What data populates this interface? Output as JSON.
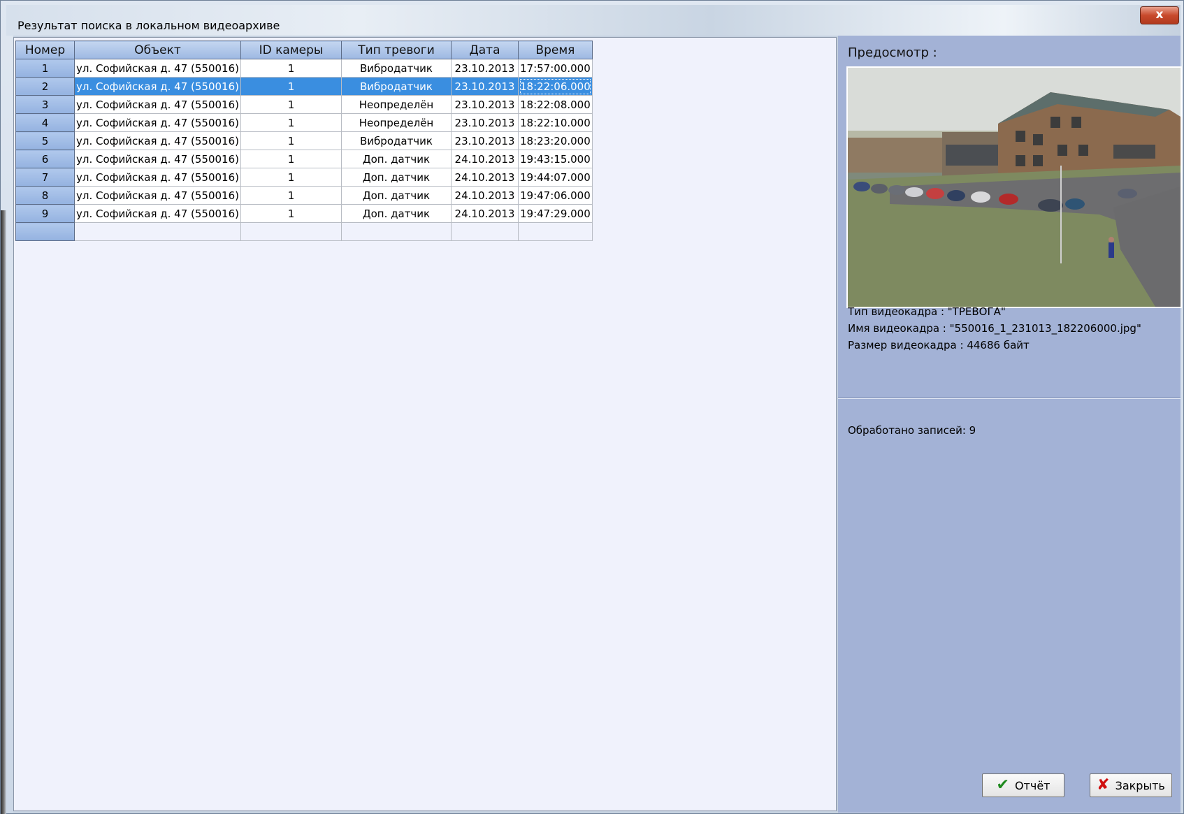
{
  "window": {
    "title": "Результат поиска в локальном видеоархиве",
    "close_label": "x"
  },
  "table": {
    "headers": [
      "Номер",
      "Объект",
      "ID камеры",
      "Тип тревоги",
      "Дата",
      "Время"
    ],
    "selected_index": 1,
    "rows": [
      {
        "num": "1",
        "object": "ул. Софийская д. 47 (550016)",
        "camera_id": "1",
        "alarm_type": "Вибродатчик",
        "date": "23.10.2013",
        "time": "17:57:00.000"
      },
      {
        "num": "2",
        "object": "ул. Софийская д. 47 (550016)",
        "camera_id": "1",
        "alarm_type": "Вибродатчик",
        "date": "23.10.2013",
        "time": "18:22:06.000"
      },
      {
        "num": "3",
        "object": "ул. Софийская д. 47 (550016)",
        "camera_id": "1",
        "alarm_type": "Неопределён",
        "date": "23.10.2013",
        "time": "18:22:08.000"
      },
      {
        "num": "4",
        "object": "ул. Софийская д. 47 (550016)",
        "camera_id": "1",
        "alarm_type": "Неопределён",
        "date": "23.10.2013",
        "time": "18:22:10.000"
      },
      {
        "num": "5",
        "object": "ул. Софийская д. 47 (550016)",
        "camera_id": "1",
        "alarm_type": "Вибродатчик",
        "date": "23.10.2013",
        "time": "18:23:20.000"
      },
      {
        "num": "6",
        "object": "ул. Софийская д. 47 (550016)",
        "camera_id": "1",
        "alarm_type": "Доп. датчик",
        "date": "24.10.2013",
        "time": "19:43:15.000"
      },
      {
        "num": "7",
        "object": "ул. Софийская д. 47 (550016)",
        "camera_id": "1",
        "alarm_type": "Доп. датчик",
        "date": "24.10.2013",
        "time": "19:44:07.000"
      },
      {
        "num": "8",
        "object": "ул. Софийская д. 47 (550016)",
        "camera_id": "1",
        "alarm_type": "Доп. датчик",
        "date": "24.10.2013",
        "time": "19:47:06.000"
      },
      {
        "num": "9",
        "object": "ул. Софийская д. 47 (550016)",
        "camera_id": "1",
        "alarm_type": "Доп. датчик",
        "date": "24.10.2013",
        "time": "19:47:29.000"
      }
    ]
  },
  "preview": {
    "label": "Предосмотр :",
    "frame_type": "Тип видеокадра : \"ТРЕВОГА\"",
    "frame_name": "Имя видеокадра : \"550016_1_231013_182206000.jpg\"",
    "frame_size": "Размер видеокадра : 44686 байт"
  },
  "status": {
    "processed": "Обработано записей: 9"
  },
  "buttons": {
    "report_label": "Отчёт",
    "close_label": "Закрыть"
  },
  "colors": {
    "selection": "#3a8ee0",
    "header": "#a9c2e8",
    "right_panel": "#a3b2d6",
    "grid_background": "#f0f2fc"
  }
}
